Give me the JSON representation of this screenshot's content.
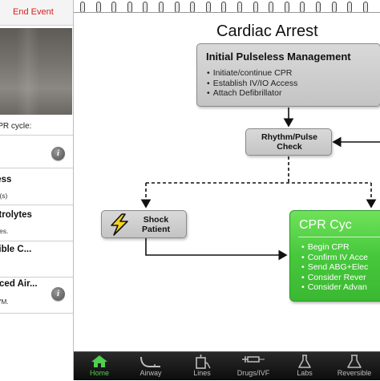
{
  "left_panel": {
    "end_event_label": "End Event",
    "cpr_cycle_label": "CPR cycle:",
    "rows": [
      {
        "title": "less",
        "sub": "ne(s)"
      },
      {
        "title": "ctrolytes",
        "sub": "uses."
      },
      {
        "title": "sible C...",
        "sub": ""
      },
      {
        "title": "nced Air...",
        "sub": "BVM."
      }
    ]
  },
  "flowchart": {
    "title": "Cardiac Arrest",
    "initial": {
      "title": "Initial Pulseless Management",
      "bullets": [
        "Initiate/continue CPR",
        "Establish IV/IO Access",
        "Attach Defibrillator"
      ]
    },
    "rhythm_check": {
      "line1": "Rhythm/Pulse",
      "line2": "Check"
    },
    "shock": {
      "line1": "Shock",
      "line2": "Patient"
    },
    "cpr_cycle": {
      "title": "CPR Cyc",
      "bullets": [
        "Begin CPR",
        "Confirm IV Acce",
        "Send ABG+Elec",
        "Consider Rever",
        "Consider Advan"
      ]
    }
  },
  "tabbar": {
    "tabs": [
      {
        "label": "Home",
        "icon": "home-icon",
        "active": true
      },
      {
        "label": "Airway",
        "icon": "airway-icon",
        "active": false
      },
      {
        "label": "Lines",
        "icon": "lines-icon",
        "active": false
      },
      {
        "label": "Drugs/IVF",
        "icon": "syringe-icon",
        "active": false
      },
      {
        "label": "Labs",
        "icon": "flask-icon",
        "active": false
      },
      {
        "label": "Reversible",
        "icon": "reversible-icon",
        "active": false
      }
    ]
  },
  "colors": {
    "end_event": "#d81f1f",
    "cpr_box": "#47c83c",
    "tab_active": "#4fcf4f"
  }
}
